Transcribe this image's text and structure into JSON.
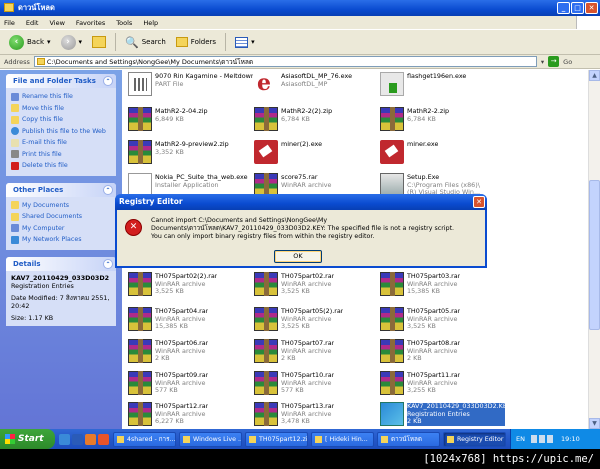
{
  "window": {
    "title": "ดาวน์โหลด"
  },
  "menu": [
    "File",
    "Edit",
    "View",
    "Favorites",
    "Tools",
    "Help"
  ],
  "toolbar": {
    "back": "Back",
    "search": "Search",
    "folders": "Folders"
  },
  "address": {
    "label": "Address",
    "value": "C:\\Documents and Settings\\NongGee\\My Documents\\ดาวน์โหลด",
    "go": "Go"
  },
  "tasks_panel": {
    "title": "File and Folder Tasks",
    "items": [
      "Rename this file",
      "Move this file",
      "Copy this file",
      "Publish this file to the Web",
      "E-mail this file",
      "Print this file",
      "Delete this file"
    ]
  },
  "places_panel": {
    "title": "Other Places",
    "items": [
      "My Documents",
      "Shared Documents",
      "My Computer",
      "My Network Places"
    ]
  },
  "details_panel": {
    "title": "Details",
    "name": "KAV7_20110429_033D03D2",
    "type": "Registration Entries",
    "modified": "Date Modified: 7 สิงหาคม 2551, 20:42",
    "size": "Size: 1.17 KB"
  },
  "files": [
    {
      "name": "9070 Rin Kagamine - Meltdown.osz.part",
      "name2": "",
      "type": "PART File",
      "size": "",
      "icon": "part"
    },
    {
      "name": "AsiasoftDL_MP_76.exe",
      "name2": "",
      "type": "AsiasoftDL_MP",
      "size": "",
      "icon": "asia"
    },
    {
      "name": "flashget196en.exe",
      "name2": "",
      "type": "",
      "size": "",
      "icon": "flash"
    },
    {
      "name": "MathR2-2-04.zip",
      "name2": "",
      "type": "6,849 KB",
      "size": "",
      "icon": "rar"
    },
    {
      "name": "MathR2-2(2).zip",
      "name2": "",
      "type": "6,784 KB",
      "size": "",
      "icon": "rar"
    },
    {
      "name": "MathR2-2.zip",
      "name2": "",
      "type": "6,784 KB",
      "size": "",
      "icon": "rar"
    },
    {
      "name": "MathR2-9-preview2.zip",
      "name2": "",
      "type": "3,352 KB",
      "size": "",
      "icon": "rar"
    },
    {
      "name": "miner(2).exe",
      "name2": "",
      "type": "",
      "size": "",
      "icon": "exe-red"
    },
    {
      "name": "miner.exe",
      "name2": "",
      "type": "",
      "size": "",
      "icon": "exe-red"
    },
    {
      "name": "Nokia_PC_Suite_tha_web.exe",
      "name2": "",
      "type": "Installer Application",
      "size": "",
      "icon": "nokia"
    },
    {
      "name": "score75.rar",
      "name2": "",
      "type": "WinRAR archive",
      "size": "",
      "icon": "rar"
    },
    {
      "name": "Setup.Exe",
      "name2": "",
      "type": "C:\\Program Files (x86)\\",
      "size": "(R) Visual Studio Win...",
      "icon": "setup"
    },
    {
      "name": "TH075part02(2).rar",
      "name2": "",
      "type": "WinRAR archive",
      "size": "3,525 KB",
      "icon": "rar"
    },
    {
      "name": "TH075part02.rar",
      "name2": "",
      "type": "WinRAR archive",
      "size": "3,525 KB",
      "icon": "rar"
    },
    {
      "name": "TH075part03.rar",
      "name2": "",
      "type": "WinRAR archive",
      "size": "15,385 KB",
      "icon": "rar"
    },
    {
      "name": "TH075part04.rar",
      "name2": "",
      "type": "WinRAR archive",
      "size": "15,385 KB",
      "icon": "rar"
    },
    {
      "name": "TH075part05(2).rar",
      "name2": "",
      "type": "WinRAR archive",
      "size": "3,525 KB",
      "icon": "rar"
    },
    {
      "name": "TH075part05.rar",
      "name2": "",
      "type": "WinRAR archive",
      "size": "3,525 KB",
      "icon": "rar"
    },
    {
      "name": "TH075part06.rar",
      "name2": "",
      "type": "WinRAR archive",
      "size": "2 KB",
      "icon": "rar"
    },
    {
      "name": "TH075part07.rar",
      "name2": "",
      "type": "WinRAR archive",
      "size": "2 KB",
      "icon": "rar"
    },
    {
      "name": "TH075part08.rar",
      "name2": "",
      "type": "WinRAR archive",
      "size": "2 KB",
      "icon": "rar"
    },
    {
      "name": "TH075part09.rar",
      "name2": "",
      "type": "WinRAR archive",
      "size": "577 KB",
      "icon": "rar"
    },
    {
      "name": "TH075part10.rar",
      "name2": "",
      "type": "WinRAR archive",
      "size": "577 KB",
      "icon": "rar"
    },
    {
      "name": "TH075part11.rar",
      "name2": "",
      "type": "WinRAR archive",
      "size": "3,255 KB",
      "icon": "rar"
    },
    {
      "name": "TH075part12.rar",
      "name2": "",
      "type": "WinRAR archive",
      "size": "6,227 KB",
      "icon": "rar"
    },
    {
      "name": "TH075part13.rar",
      "name2": "",
      "type": "WinRAR archive",
      "size": "3,478 KB",
      "icon": "rar"
    },
    {
      "name": "KAV7_20110429_033D03D2.KEY",
      "name2": "",
      "type": "Registration Entries",
      "size": "2 KB",
      "icon": "reg",
      "selected": true
    }
  ],
  "dialog": {
    "title": "Registry Editor",
    "message": "Cannot import C:\\Documents and Settings\\NongGee\\My Documents\\ดาวน์โหลด\\KAV7_20110429_033D03D2.KEY: The specified file is not a registry script.",
    "message2": "You can only import binary registry files from within the registry editor.",
    "ok": "OK"
  },
  "taskbar": {
    "start": "Start",
    "tasks": [
      "4shared - การ...",
      "Windows Live ...",
      "TH075part12.zip",
      "[ Hideki Hin...",
      "ดาวน์โหลด",
      "Registry Editor"
    ],
    "lang": "EN",
    "clock": "19:10"
  },
  "watermark": "[1024x768] https://upic.me/"
}
